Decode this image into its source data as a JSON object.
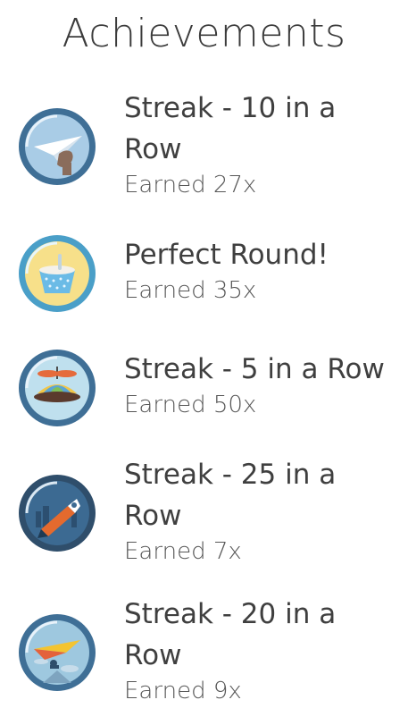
{
  "page": {
    "title": "Achievements"
  },
  "achievements": [
    {
      "name": "Streak - 10 in a Row",
      "earned": "Earned 27x",
      "icon": "paper-plane-icon"
    },
    {
      "name": "Perfect Round!",
      "earned": "Earned 35x",
      "icon": "ice-cream-cup-icon"
    },
    {
      "name": "Streak - 5 in a Row",
      "earned": "Earned 50x",
      "icon": "propeller-hat-icon"
    },
    {
      "name": "Streak - 25 in a Row",
      "earned": "Earned 7x",
      "icon": "rocket-icon"
    },
    {
      "name": "Streak - 20 in a Row",
      "earned": "Earned 9x",
      "icon": "hang-glider-icon"
    }
  ],
  "colors": {
    "ring_blue": "#3f6f96",
    "ring_teal": "#4a9fc8",
    "sky": "#a9cce6",
    "dark_navy": "#2f4e6b"
  }
}
